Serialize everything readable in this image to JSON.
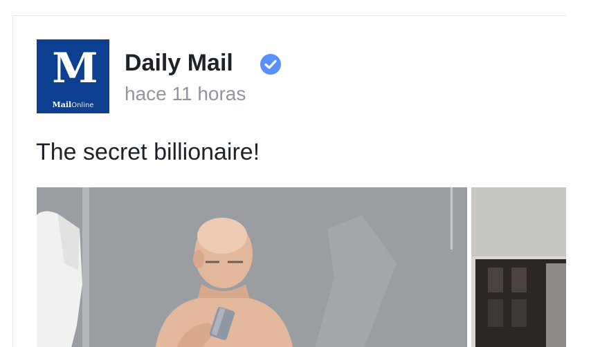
{
  "post": {
    "page_name": "Daily Mail",
    "verified": true,
    "timestamp": "hace 11 horas",
    "message": "The secret billionaire!"
  },
  "logo": {
    "mark": "M",
    "strip_brand": "Mail",
    "strip_suffix": "Online",
    "background": "#0c3f90"
  },
  "icons": {
    "verified": "verified-badge-icon"
  },
  "colors": {
    "name_text": "#1d2129",
    "meta_text": "#90949c",
    "verified_badge": "#5890ff"
  }
}
